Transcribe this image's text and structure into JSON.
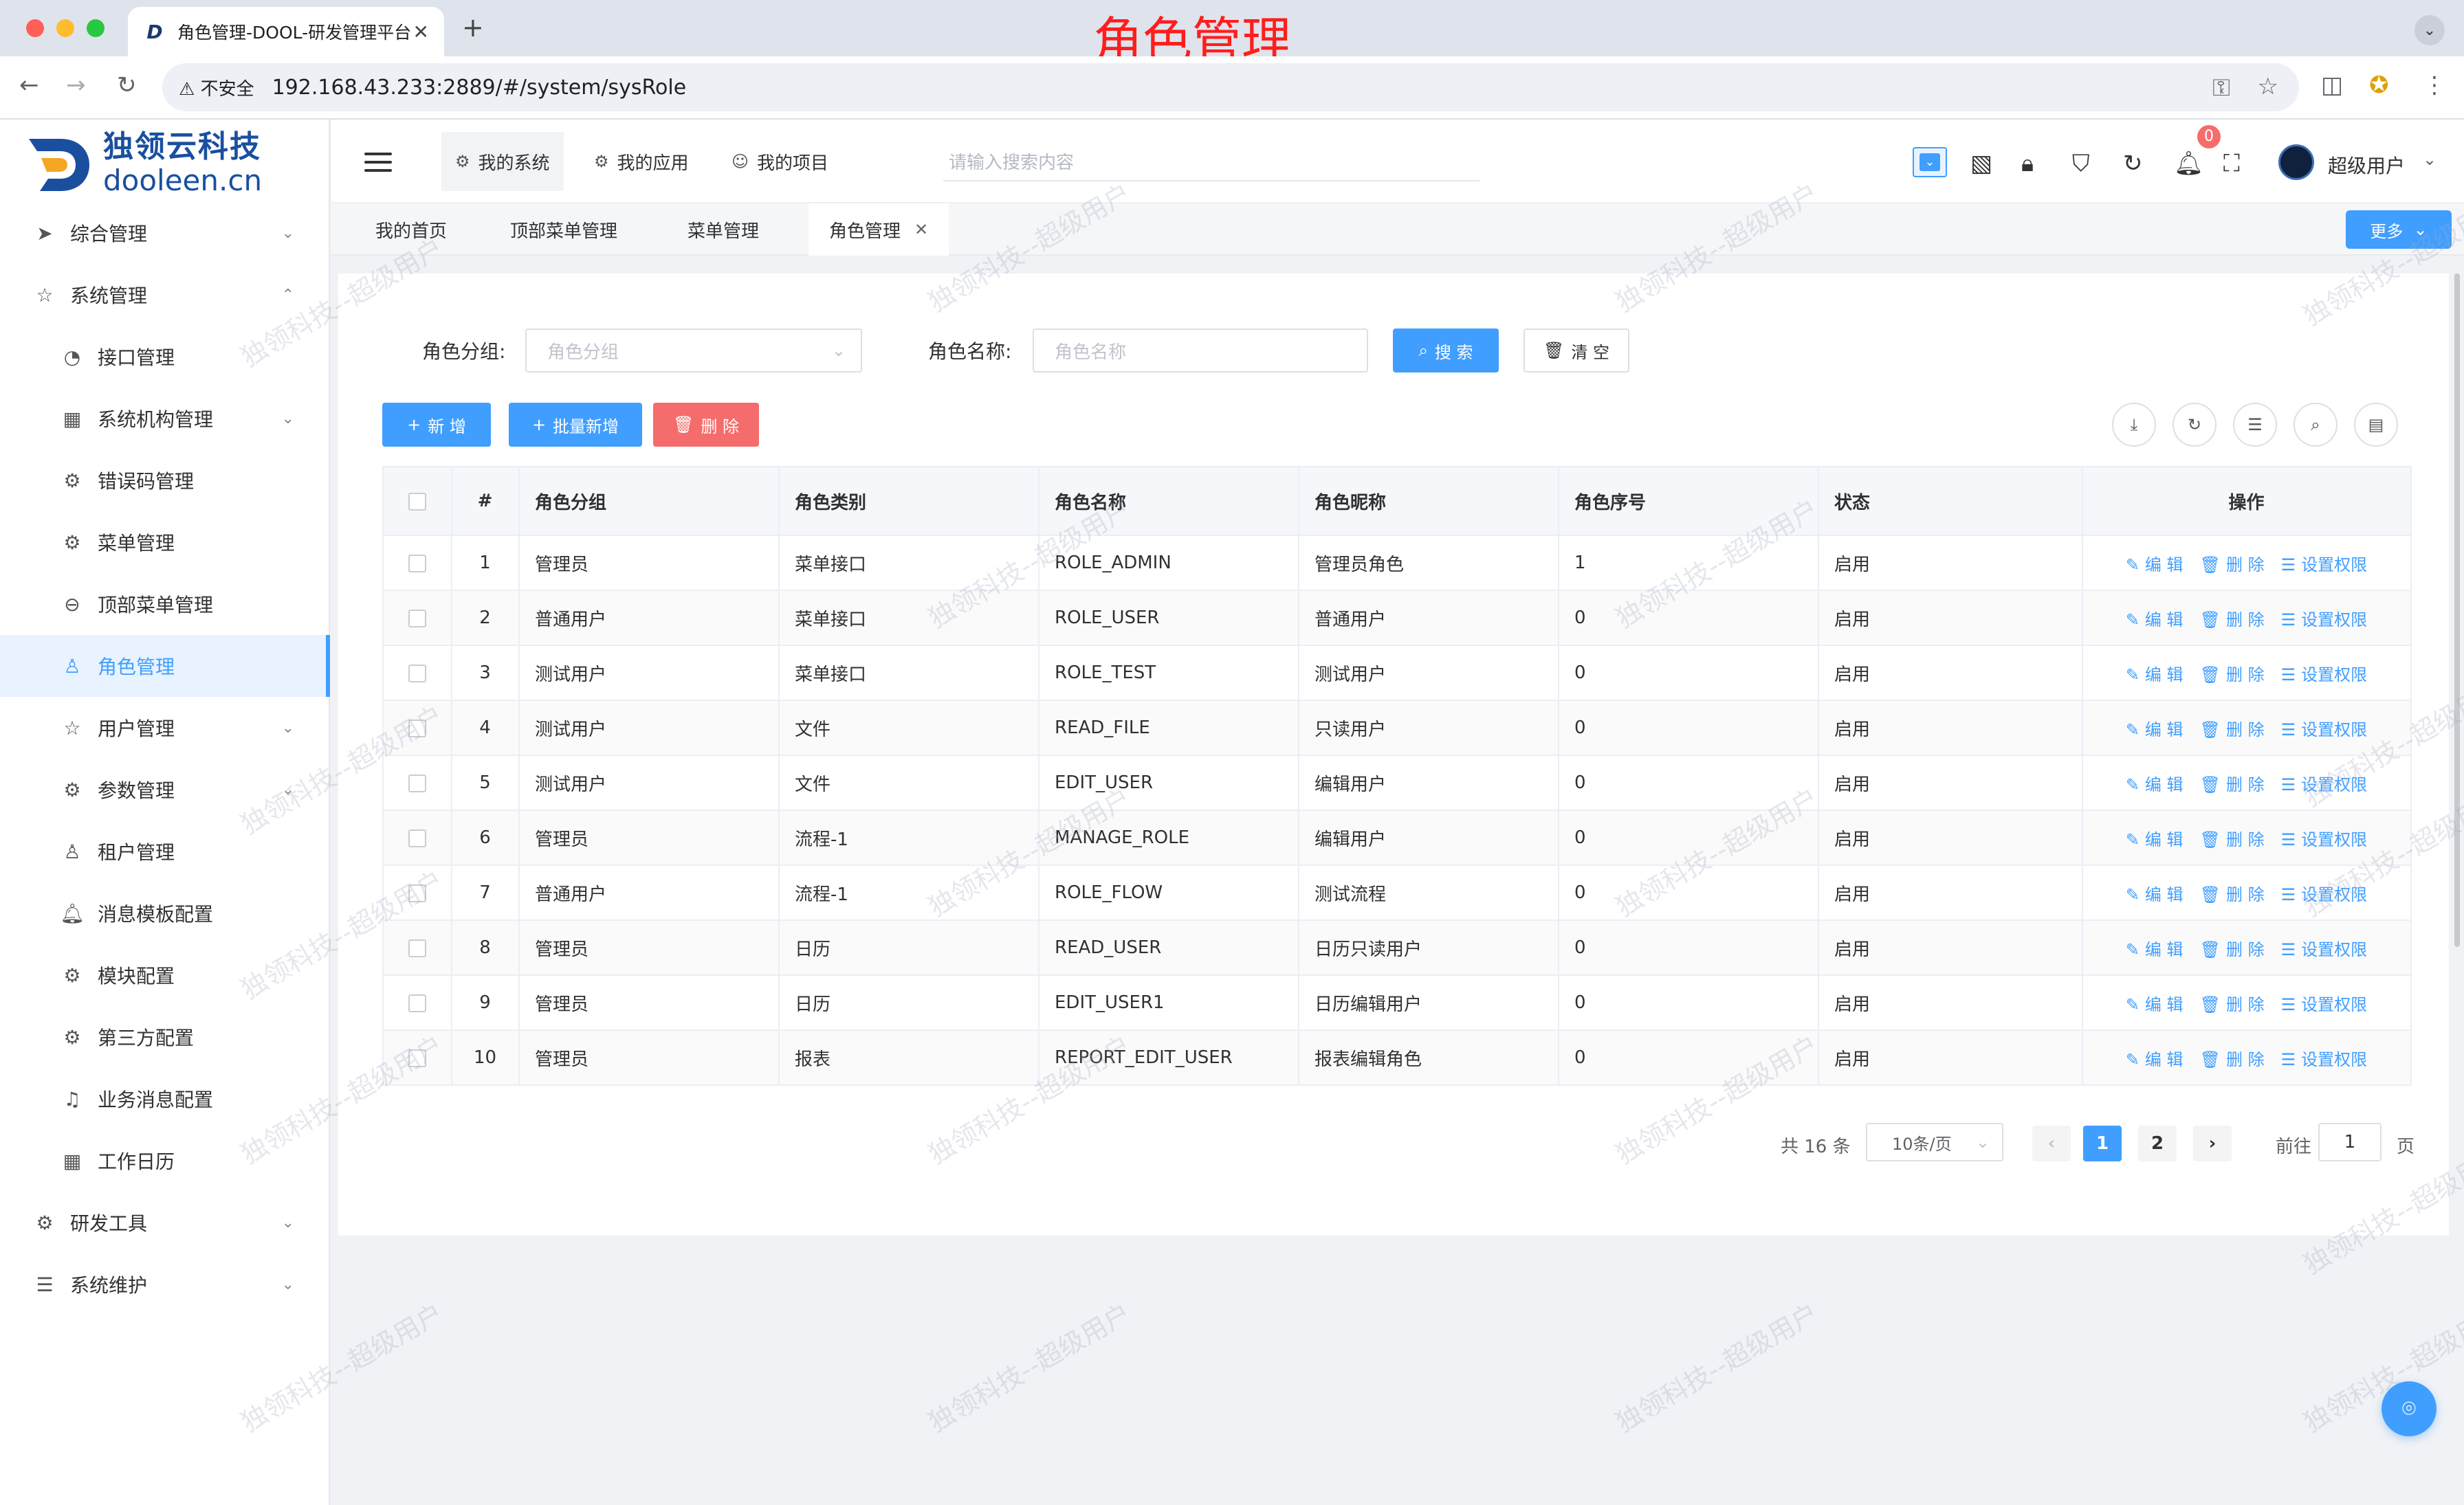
{
  "browser": {
    "tab_title": "角色管理-DOOL-研发管理平台",
    "insecure_label": "不安全",
    "url": "192.168.43.233:2889/#/system/sysRole",
    "overlay_title": "角色管理"
  },
  "logo": {
    "cn": "独领云科技",
    "en": "dooleen.cn"
  },
  "sidebar": {
    "items": [
      {
        "label": "综合管理",
        "icon": "send-icon",
        "level": 1,
        "expandable": true
      },
      {
        "label": "系统管理",
        "icon": "star-icon",
        "level": 1,
        "expanded": true
      },
      {
        "label": "接口管理",
        "icon": "gauge-icon",
        "level": 2
      },
      {
        "label": "系统机构管理",
        "icon": "grid-icon",
        "level": 2,
        "expandable": true
      },
      {
        "label": "错误码管理",
        "icon": "gear-icon",
        "level": 2
      },
      {
        "label": "菜单管理",
        "icon": "gear-outline-icon",
        "level": 2
      },
      {
        "label": "顶部菜单管理",
        "icon": "search-circle-icon",
        "level": 2
      },
      {
        "label": "角色管理",
        "icon": "user-icon",
        "level": 2,
        "active": true
      },
      {
        "label": "用户管理",
        "icon": "star-icon",
        "level": 2,
        "expandable": true
      },
      {
        "label": "参数管理",
        "icon": "gear-outline-icon",
        "level": 2,
        "expandable": true
      },
      {
        "label": "租户管理",
        "icon": "user-icon",
        "level": 2
      },
      {
        "label": "消息模板配置",
        "icon": "bell-filled-icon",
        "level": 2
      },
      {
        "label": "模块配置",
        "icon": "gear-outline-icon",
        "level": 2
      },
      {
        "label": "第三方配置",
        "icon": "gear-outline-icon",
        "level": 2
      },
      {
        "label": "业务消息配置",
        "icon": "bell-icon",
        "level": 2
      },
      {
        "label": "工作日历",
        "icon": "calendar-icon",
        "level": 2
      },
      {
        "label": "研发工具",
        "icon": "gear-outline-icon",
        "level": 1,
        "expandable": true
      },
      {
        "label": "系统维护",
        "icon": "sliders-icon",
        "level": 1,
        "expandable": true
      }
    ]
  },
  "header": {
    "sys_tabs": [
      "我的系统",
      "我的应用",
      "我的项目"
    ],
    "search_placeholder": "请输入搜索内容",
    "notice_count": "0",
    "username": "超级用户"
  },
  "page_tabs": {
    "items": [
      "我的首页",
      "顶部菜单管理",
      "菜单管理",
      "角色管理"
    ],
    "more_label": "更多"
  },
  "filters": {
    "group_label": "角色分组:",
    "group_placeholder": "角色分组",
    "name_label": "角色名称:",
    "name_placeholder": "角色名称",
    "search_btn": "搜 索",
    "clear_btn": "清 空"
  },
  "actions": {
    "add": "新 增",
    "batch_add": "批量新增",
    "delete": "删 除"
  },
  "table": {
    "headers": [
      "#",
      "角色分组",
      "角色类别",
      "角色名称",
      "角色昵称",
      "角色序号",
      "状态",
      "操作"
    ],
    "op_labels": {
      "edit": "编 辑",
      "delete": "删 除",
      "perm": "设置权限"
    },
    "rows": [
      {
        "no": "1",
        "group": "管理员",
        "category": "菜单接口",
        "name": "ROLE_ADMIN",
        "nick": "管理员角色",
        "seq": "1",
        "status": "启用"
      },
      {
        "no": "2",
        "group": "普通用户",
        "category": "菜单接口",
        "name": "ROLE_USER",
        "nick": "普通用户",
        "seq": "0",
        "status": "启用"
      },
      {
        "no": "3",
        "group": "测试用户",
        "category": "菜单接口",
        "name": "ROLE_TEST",
        "nick": "测试用户",
        "seq": "0",
        "status": "启用"
      },
      {
        "no": "4",
        "group": "测试用户",
        "category": "文件",
        "name": "READ_FILE",
        "nick": "只读用户",
        "seq": "0",
        "status": "启用"
      },
      {
        "no": "5",
        "group": "测试用户",
        "category": "文件",
        "name": "EDIT_USER",
        "nick": "编辑用户",
        "seq": "0",
        "status": "启用"
      },
      {
        "no": "6",
        "group": "管理员",
        "category": "流程-1",
        "name": "MANAGE_ROLE",
        "nick": "编辑用户",
        "seq": "0",
        "status": "启用"
      },
      {
        "no": "7",
        "group": "普通用户",
        "category": "流程-1",
        "name": "ROLE_FLOW",
        "nick": "测试流程",
        "seq": "0",
        "status": "启用"
      },
      {
        "no": "8",
        "group": "管理员",
        "category": "日历",
        "name": "READ_USER",
        "nick": "日历只读用户",
        "seq": "0",
        "status": "启用"
      },
      {
        "no": "9",
        "group": "管理员",
        "category": "日历",
        "name": "EDIT_USER1",
        "nick": "日历编辑用户",
        "seq": "0",
        "status": "启用"
      },
      {
        "no": "10",
        "group": "管理员",
        "category": "报表",
        "name": "REPORT_EDIT_USER",
        "nick": "报表编辑角色",
        "seq": "0",
        "status": "启用"
      }
    ]
  },
  "pagination": {
    "total": "共 16 条",
    "page_size": "10条/页",
    "pages": [
      "1",
      "2"
    ],
    "current": "1",
    "goto_label": "前往",
    "goto_value": "1",
    "page_unit": "页"
  },
  "watermark": "独领科技--超级用户",
  "colors": {
    "primary": "#409eff",
    "danger": "#f56c6c",
    "overlay_red": "#ff1d1d",
    "logo_blue": "#1a4fa0"
  }
}
